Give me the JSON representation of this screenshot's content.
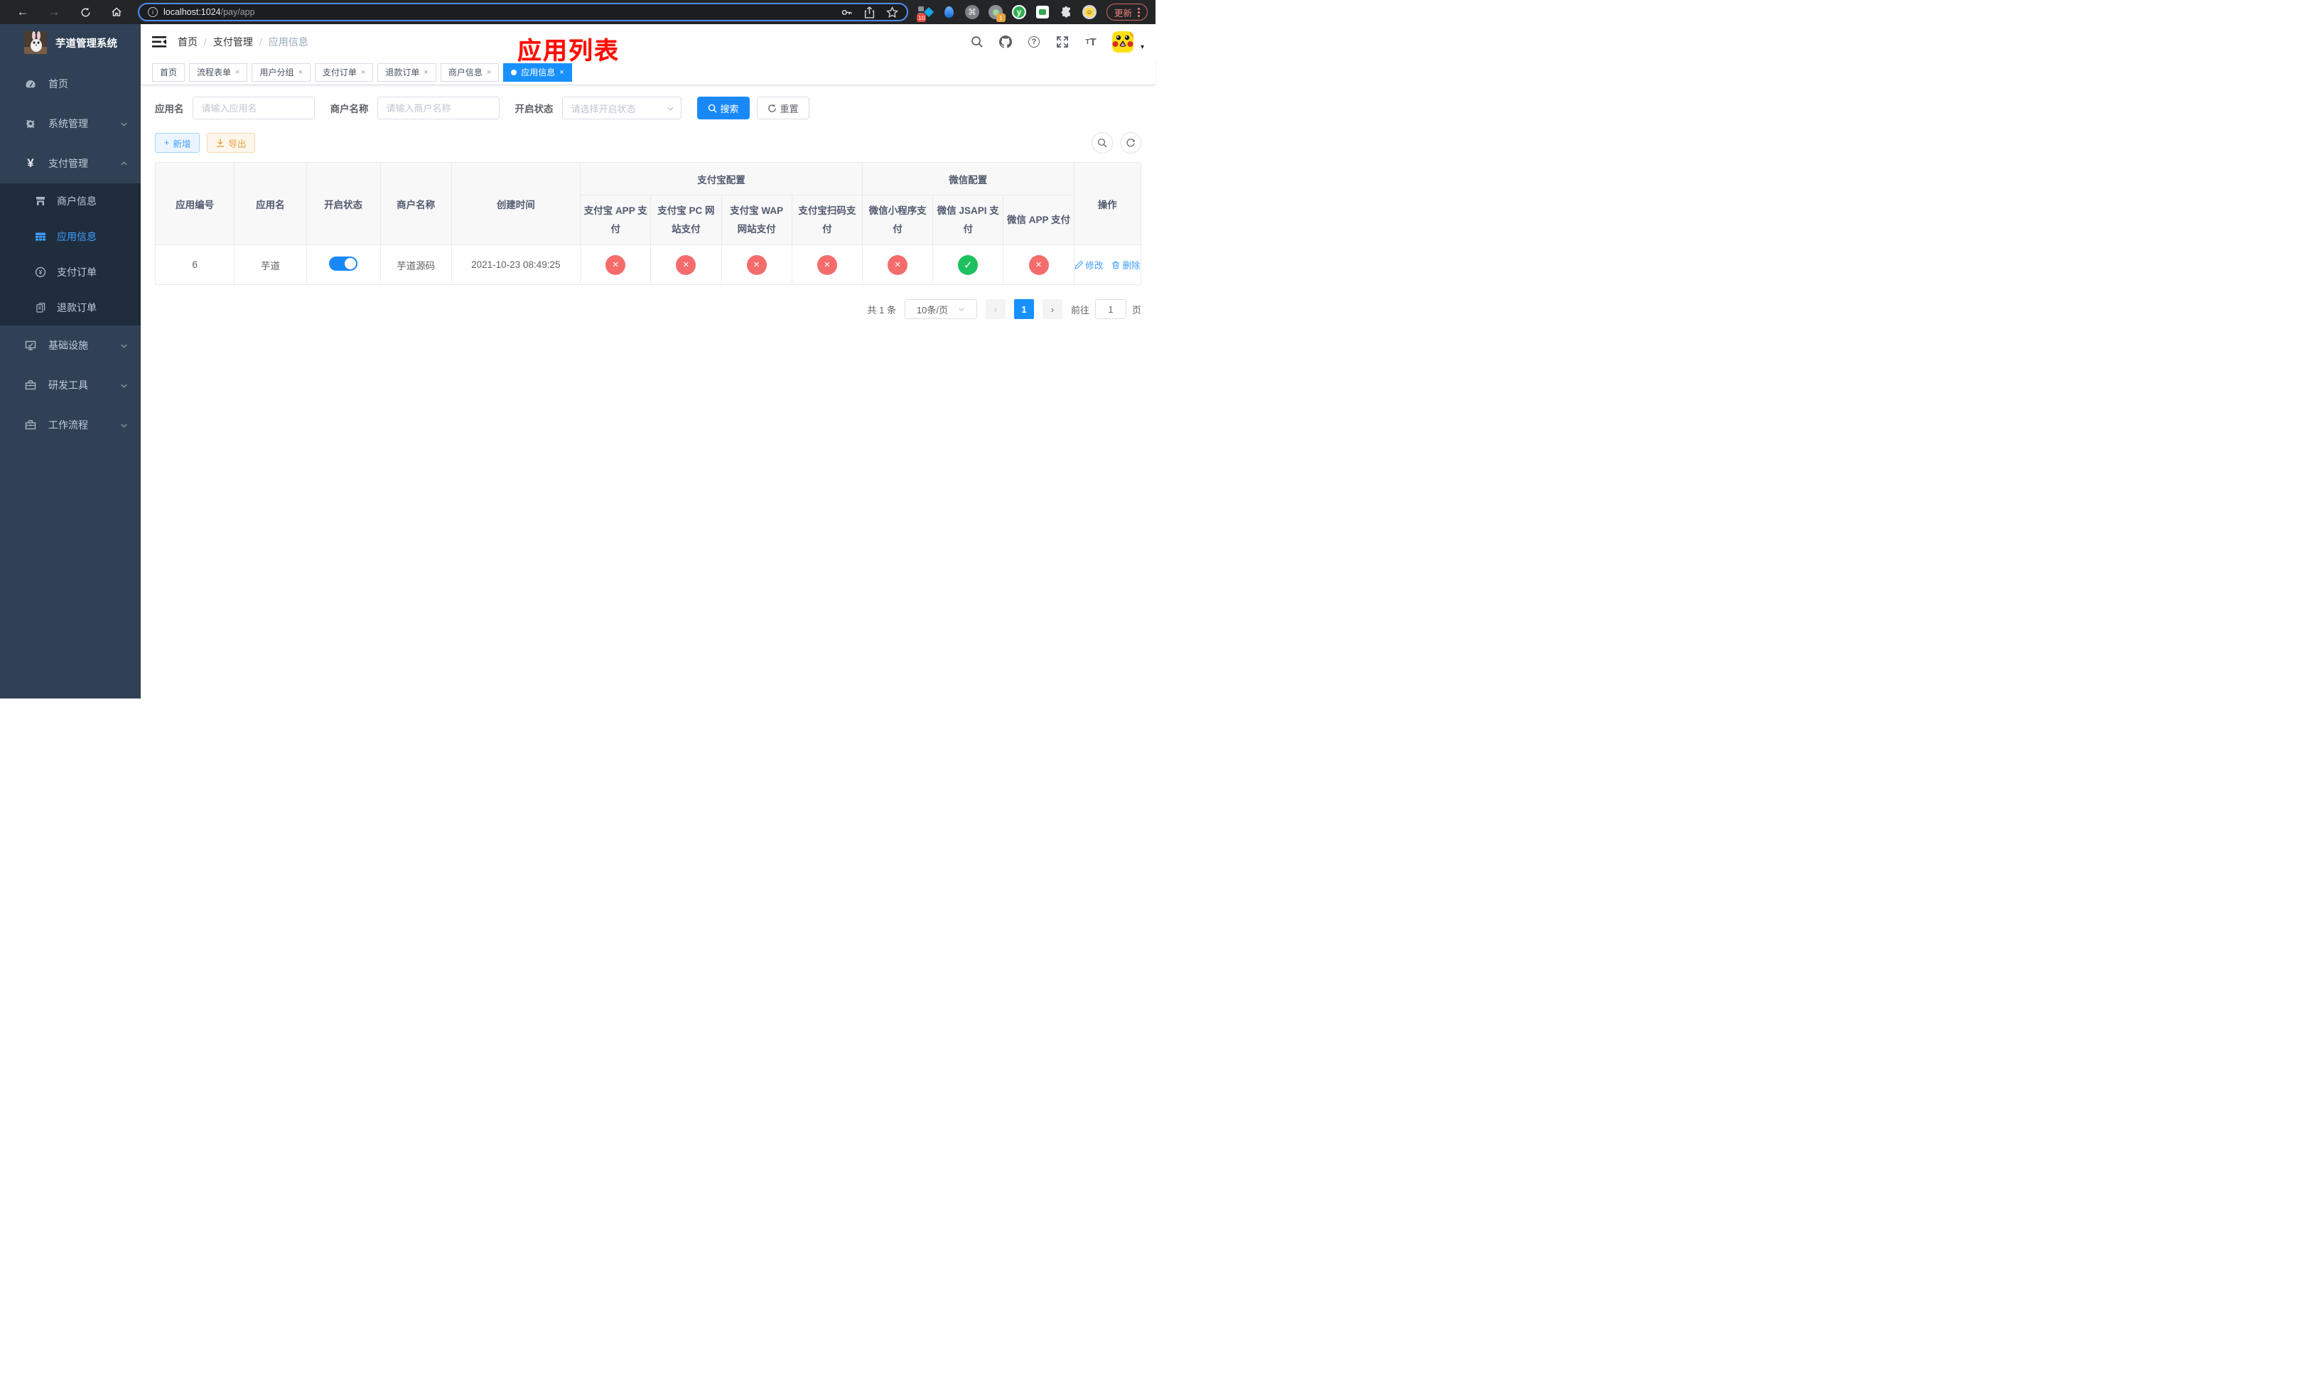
{
  "browser": {
    "url_host": "localhost:1024",
    "url_path": "/pay/app",
    "info_glyph": "i",
    "update_button": "更新",
    "ext_badge_blue_diamond": "10",
    "ext_badge_record": "1",
    "ext_y_letter": "y",
    "smiley_glyph": "☺"
  },
  "colors": {
    "primary": "#1989fa",
    "tab_active": "#1890ff",
    "success": "#1ec15f",
    "danger": "#f56c6c",
    "warning": "#e6a23c",
    "sidebar_bg": "#304156",
    "submenu_bg": "#1f2d3d",
    "annotation": "#ff0d00"
  },
  "sidebar": {
    "title": "芋道管理系统",
    "items": [
      {
        "label": "首页"
      },
      {
        "label": "系统管理"
      },
      {
        "label": "支付管理"
      },
      {
        "label": "基础设施"
      },
      {
        "label": "研发工具"
      },
      {
        "label": "工作流程"
      }
    ],
    "submenu": [
      {
        "label": "商户信息"
      },
      {
        "label": "应用信息"
      },
      {
        "label": "支付订单"
      },
      {
        "label": "退款订单"
      }
    ]
  },
  "header": {
    "breadcrumb": [
      "首页",
      "支付管理",
      "应用信息"
    ],
    "separator": "/",
    "annotation": "应用列表",
    "help_glyph": "?",
    "font_small": "T",
    "font_big": "T"
  },
  "tabs": [
    {
      "label": "首页"
    },
    {
      "label": "流程表单"
    },
    {
      "label": "用户分组"
    },
    {
      "label": "支付订单"
    },
    {
      "label": "退款订单"
    },
    {
      "label": "商户信息"
    },
    {
      "label": "应用信息"
    }
  ],
  "filters": {
    "app_name_label": "应用名",
    "app_name_placeholder": "请输入应用名",
    "merchant_label": "商户名称",
    "merchant_placeholder": "请输入商户名称",
    "status_label": "开启状态",
    "status_placeholder": "请选择开启状态",
    "search_button": "搜索",
    "reset_button": "重置"
  },
  "toolbar": {
    "add_button": "新增",
    "export_button": "导出"
  },
  "table": {
    "group_headers": {
      "alipay": "支付宝配置",
      "wechat": "微信配置"
    },
    "columns": [
      "应用编号",
      "应用名",
      "开启状态",
      "商户名称",
      "创建时间",
      "支付宝 APP 支付",
      "支付宝 PC 网站支付",
      "支付宝 WAP 网站支付",
      "支付宝扫码支付",
      "微信小程序支付",
      "微信 JSAPI 支付",
      "微信 APP 支付",
      "操作"
    ],
    "row": {
      "id": "6",
      "name": "芋道",
      "enabled": true,
      "merchant": "芋道源码",
      "created": "2021-10-23 08:49:25",
      "statuses": [
        "disabled",
        "disabled",
        "disabled",
        "disabled",
        "disabled",
        "enabled",
        "disabled"
      ],
      "status_glyphs": {
        "enabled": "✓",
        "disabled": "×"
      },
      "edit_label": "修改",
      "delete_label": "删除"
    }
  },
  "pagination": {
    "total": "共 1 条",
    "page_size": "10条/页",
    "current_page": "1",
    "goto_label": "前往",
    "goto_value": "1",
    "page_suffix": "页"
  }
}
